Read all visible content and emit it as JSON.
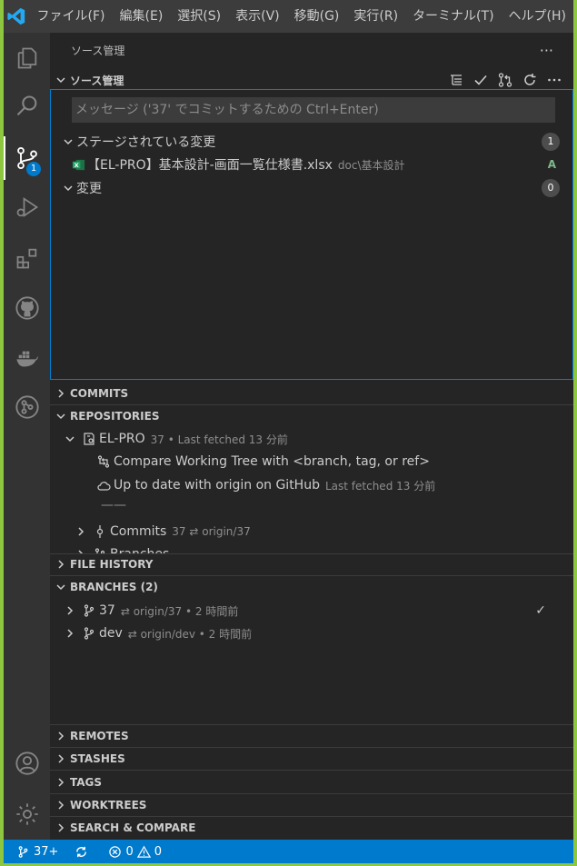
{
  "menu": [
    "ファイル(F)",
    "編集(E)",
    "選択(S)",
    "表示(V)",
    "移動(G)",
    "実行(R)",
    "ターミナル(T)",
    "ヘルプ(H)"
  ],
  "activity": {
    "scm_badge": "1"
  },
  "sidebar": {
    "title": "ソース管理",
    "more": "···"
  },
  "scm": {
    "header": "ソース管理",
    "commit_placeholder": "メッセージ ('37' でコミットするための Ctrl+Enter)",
    "staged_label": "ステージされている変更",
    "staged_count": "1",
    "file_name": "【EL-PRO】基本設計-画面一覧仕様書.xlsx",
    "file_path": "doc\\基本設計",
    "file_status": "A",
    "changes_label": "変更",
    "changes_count": "0"
  },
  "sections": {
    "commits": "COMMITS",
    "repositories": "REPOSITORIES",
    "file_history": "FILE HISTORY",
    "branches": "BRANCHES (2)",
    "remotes": "REMOTES",
    "stashes": "STASHES",
    "tags": "TAGS",
    "worktrees": "WORKTREES",
    "search_compare": "SEARCH & COMPARE"
  },
  "repositories": {
    "repo_name": "EL-PRO",
    "repo_meta": "37 • Last fetched 13 分前",
    "compare": "Compare Working Tree with <branch, tag, or ref>",
    "uptodate": "Up to date with origin on GitHub",
    "uptodate_meta": "Last fetched 13 分前",
    "divider": "——",
    "commits_label": "Commits",
    "commits_meta": "37 ⇄ origin/37",
    "branches_partial": "Branches"
  },
  "branches": [
    {
      "name": "37",
      "meta": "⇄ origin/37 • 2 時間前",
      "check": "✓"
    },
    {
      "name": "dev",
      "meta": "⇄ origin/dev • 2 時間前",
      "check": ""
    }
  ],
  "statusbar": {
    "branch": "37+",
    "errors": "0",
    "warnings": "0"
  }
}
